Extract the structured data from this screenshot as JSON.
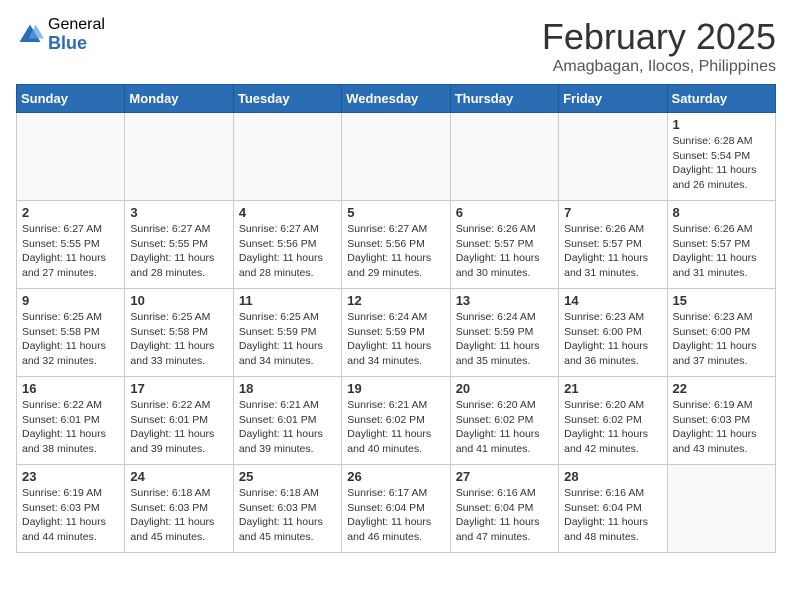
{
  "logo": {
    "general": "General",
    "blue": "Blue"
  },
  "title": "February 2025",
  "subtitle": "Amagbagan, Ilocos, Philippines",
  "days_of_week": [
    "Sunday",
    "Monday",
    "Tuesday",
    "Wednesday",
    "Thursday",
    "Friday",
    "Saturday"
  ],
  "weeks": [
    [
      {
        "day": "",
        "info": ""
      },
      {
        "day": "",
        "info": ""
      },
      {
        "day": "",
        "info": ""
      },
      {
        "day": "",
        "info": ""
      },
      {
        "day": "",
        "info": ""
      },
      {
        "day": "",
        "info": ""
      },
      {
        "day": "1",
        "info": "Sunrise: 6:28 AM\nSunset: 5:54 PM\nDaylight: 11 hours and 26 minutes."
      }
    ],
    [
      {
        "day": "2",
        "info": "Sunrise: 6:27 AM\nSunset: 5:55 PM\nDaylight: 11 hours and 27 minutes."
      },
      {
        "day": "3",
        "info": "Sunrise: 6:27 AM\nSunset: 5:55 PM\nDaylight: 11 hours and 28 minutes."
      },
      {
        "day": "4",
        "info": "Sunrise: 6:27 AM\nSunset: 5:56 PM\nDaylight: 11 hours and 28 minutes."
      },
      {
        "day": "5",
        "info": "Sunrise: 6:27 AM\nSunset: 5:56 PM\nDaylight: 11 hours and 29 minutes."
      },
      {
        "day": "6",
        "info": "Sunrise: 6:26 AM\nSunset: 5:57 PM\nDaylight: 11 hours and 30 minutes."
      },
      {
        "day": "7",
        "info": "Sunrise: 6:26 AM\nSunset: 5:57 PM\nDaylight: 11 hours and 31 minutes."
      },
      {
        "day": "8",
        "info": "Sunrise: 6:26 AM\nSunset: 5:57 PM\nDaylight: 11 hours and 31 minutes."
      }
    ],
    [
      {
        "day": "9",
        "info": "Sunrise: 6:25 AM\nSunset: 5:58 PM\nDaylight: 11 hours and 32 minutes."
      },
      {
        "day": "10",
        "info": "Sunrise: 6:25 AM\nSunset: 5:58 PM\nDaylight: 11 hours and 33 minutes."
      },
      {
        "day": "11",
        "info": "Sunrise: 6:25 AM\nSunset: 5:59 PM\nDaylight: 11 hours and 34 minutes."
      },
      {
        "day": "12",
        "info": "Sunrise: 6:24 AM\nSunset: 5:59 PM\nDaylight: 11 hours and 34 minutes."
      },
      {
        "day": "13",
        "info": "Sunrise: 6:24 AM\nSunset: 5:59 PM\nDaylight: 11 hours and 35 minutes."
      },
      {
        "day": "14",
        "info": "Sunrise: 6:23 AM\nSunset: 6:00 PM\nDaylight: 11 hours and 36 minutes."
      },
      {
        "day": "15",
        "info": "Sunrise: 6:23 AM\nSunset: 6:00 PM\nDaylight: 11 hours and 37 minutes."
      }
    ],
    [
      {
        "day": "16",
        "info": "Sunrise: 6:22 AM\nSunset: 6:01 PM\nDaylight: 11 hours and 38 minutes."
      },
      {
        "day": "17",
        "info": "Sunrise: 6:22 AM\nSunset: 6:01 PM\nDaylight: 11 hours and 39 minutes."
      },
      {
        "day": "18",
        "info": "Sunrise: 6:21 AM\nSunset: 6:01 PM\nDaylight: 11 hours and 39 minutes."
      },
      {
        "day": "19",
        "info": "Sunrise: 6:21 AM\nSunset: 6:02 PM\nDaylight: 11 hours and 40 minutes."
      },
      {
        "day": "20",
        "info": "Sunrise: 6:20 AM\nSunset: 6:02 PM\nDaylight: 11 hours and 41 minutes."
      },
      {
        "day": "21",
        "info": "Sunrise: 6:20 AM\nSunset: 6:02 PM\nDaylight: 11 hours and 42 minutes."
      },
      {
        "day": "22",
        "info": "Sunrise: 6:19 AM\nSunset: 6:03 PM\nDaylight: 11 hours and 43 minutes."
      }
    ],
    [
      {
        "day": "23",
        "info": "Sunrise: 6:19 AM\nSunset: 6:03 PM\nDaylight: 11 hours and 44 minutes."
      },
      {
        "day": "24",
        "info": "Sunrise: 6:18 AM\nSunset: 6:03 PM\nDaylight: 11 hours and 45 minutes."
      },
      {
        "day": "25",
        "info": "Sunrise: 6:18 AM\nSunset: 6:03 PM\nDaylight: 11 hours and 45 minutes."
      },
      {
        "day": "26",
        "info": "Sunrise: 6:17 AM\nSunset: 6:04 PM\nDaylight: 11 hours and 46 minutes."
      },
      {
        "day": "27",
        "info": "Sunrise: 6:16 AM\nSunset: 6:04 PM\nDaylight: 11 hours and 47 minutes."
      },
      {
        "day": "28",
        "info": "Sunrise: 6:16 AM\nSunset: 6:04 PM\nDaylight: 11 hours and 48 minutes."
      },
      {
        "day": "",
        "info": ""
      }
    ]
  ]
}
